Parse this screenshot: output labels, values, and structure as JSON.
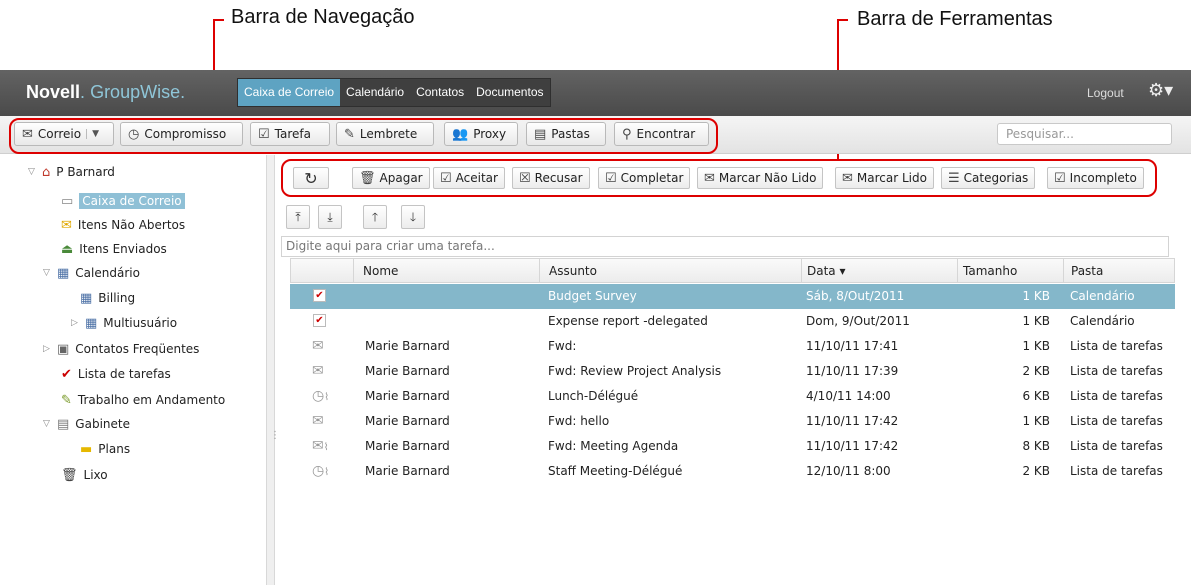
{
  "annotations": {
    "nav_bar": "Barra de Navegação",
    "tool_bar": "Barra de Ferramentas"
  },
  "header": {
    "brand_name": "Novell",
    "brand_dot": ".",
    "brand_product": "GroupWise.",
    "tabs": [
      {
        "label": "Caixa de Correio",
        "active": true
      },
      {
        "label": "Calendário",
        "active": false
      },
      {
        "label": "Contatos",
        "active": false
      },
      {
        "label": "Documentos",
        "active": false
      }
    ],
    "logout": "Logout"
  },
  "navbar": {
    "mail": "Correio",
    "appointment": "Compromisso",
    "task": "Tarefa",
    "reminder": "Lembrete",
    "proxy": "Proxy",
    "folders": "Pastas",
    "find": "Encontrar",
    "search_placeholder": "Pesquisar..."
  },
  "sidebar": {
    "user": "P Barnard",
    "items": [
      {
        "label": "Caixa de Correio",
        "selected": true
      },
      {
        "label": "Itens Não Abertos"
      },
      {
        "label": "Itens Enviados"
      },
      {
        "label": "Calendário"
      },
      {
        "label": "Billing"
      },
      {
        "label": "Multiusuário"
      },
      {
        "label": "Contatos Freqüentes"
      },
      {
        "label": "Lista de tarefas"
      },
      {
        "label": "Trabalho em Andamento"
      },
      {
        "label": "Gabinete"
      },
      {
        "label": "Plans"
      },
      {
        "label": "Lixo"
      }
    ]
  },
  "toolbar": {
    "delete": "Apagar",
    "accept": "Aceitar",
    "decline": "Recusar",
    "complete": "Completar",
    "mark_unread": "Marcar Não Lido",
    "mark_read": "Marcar Lido",
    "categories": "Categorias",
    "incomplete": "Incompleto"
  },
  "quick_task_placeholder": "Digite aqui para criar uma tarefa...",
  "table": {
    "columns": [
      "Nome",
      "Assunto",
      "Data ▾",
      "Tamanho",
      "Pasta"
    ],
    "rows": [
      {
        "type": "task",
        "name": "",
        "subject": "Budget Survey",
        "date": "Sáb, 8/Out/2011",
        "size": "1 KB",
        "folder": "Calendário",
        "selected": true
      },
      {
        "type": "task",
        "name": "",
        "subject": "Expense report -delegated",
        "date": "Dom, 9/Out/2011",
        "size": "1 KB",
        "folder": "Calendário"
      },
      {
        "type": "mail",
        "name": "Marie Barnard",
        "subject": "Fwd:",
        "date": "11/10/11 17:41",
        "size": "1 KB",
        "folder": "Lista de tarefas"
      },
      {
        "type": "mail",
        "name": "Marie Barnard",
        "subject": "Fwd: Review Project Analysis",
        "date": "11/10/11 17:39",
        "size": "2 KB",
        "folder": "Lista de tarefas"
      },
      {
        "type": "appt",
        "name": "Marie Barnard",
        "subject": "Lunch-Délégué",
        "date": "4/10/11 14:00",
        "size": "6 KB",
        "folder": "Lista de tarefas"
      },
      {
        "type": "mail",
        "name": "Marie Barnard",
        "subject": "Fwd: hello",
        "date": "11/10/11 17:42",
        "size": "1 KB",
        "folder": "Lista de tarefas"
      },
      {
        "type": "mail-attach",
        "name": "Marie Barnard",
        "subject": "Fwd: Meeting Agenda",
        "date": "11/10/11 17:42",
        "size": "8 KB",
        "folder": "Lista de tarefas"
      },
      {
        "type": "appt",
        "name": "Marie Barnard",
        "subject": "Staff Meeting-Délégué",
        "date": "12/10/11 8:00",
        "size": "2 KB",
        "folder": "Lista de tarefas"
      }
    ]
  }
}
